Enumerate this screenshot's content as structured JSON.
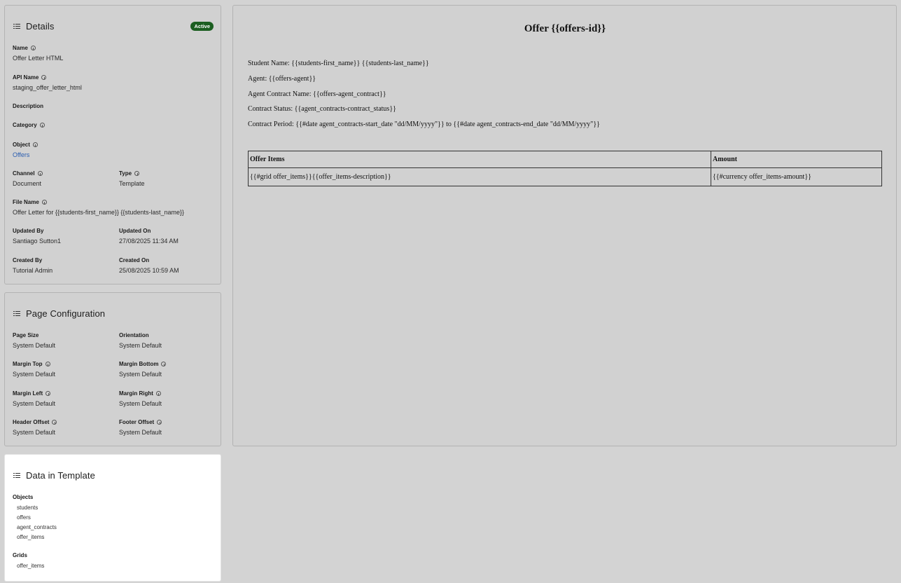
{
  "details": {
    "title": "Details",
    "status_badge": "Active",
    "name_label": "Name",
    "name_value": "Offer Letter HTML",
    "api_name_label": "API Name",
    "api_name_value": "staging_offer_letter_html",
    "description_label": "Description",
    "category_label": "Category",
    "object_label": "Object",
    "object_value": "Offers",
    "channel_label": "Channel",
    "channel_value": "Document",
    "type_label": "Type",
    "type_value": "Template",
    "file_name_label": "File Name",
    "file_name_value": "Offer Letter for {{students-first_name}} {{students-last_name}}",
    "updated_by_label": "Updated By",
    "updated_by_value": "Santiago Sutton1",
    "updated_on_label": "Updated On",
    "updated_on_value": "27/08/2025 11:34 AM",
    "created_by_label": "Created By",
    "created_by_value": "Tutorial Admin",
    "created_on_label": "Created On",
    "created_on_value": "25/08/2025 10:59 AM",
    "accent_color": "#1b5e20",
    "link_color": "#2a5db0"
  },
  "page_config": {
    "title": "Page Configuration",
    "page_size_label": "Page Size",
    "page_size_value": "System Default",
    "orientation_label": "Orientation",
    "orientation_value": "System Default",
    "margin_top_label": "Margin Top",
    "margin_top_value": "System Default",
    "margin_bottom_label": "Margin Bottom",
    "margin_bottom_value": "System Default",
    "margin_left_label": "Margin Left",
    "margin_left_value": "System Default",
    "margin_right_label": "Margin Right",
    "margin_right_value": "System Default",
    "header_offset_label": "Header Offset",
    "header_offset_value": "System Default",
    "footer_offset_label": "Footer Offset",
    "footer_offset_value": "System Default"
  },
  "data_in_template": {
    "title": "Data in Template",
    "objects_label": "Objects",
    "objects": [
      "students",
      "offers",
      "agent_contracts",
      "offer_items"
    ],
    "grids_label": "Grids",
    "grids": [
      "offer_items"
    ]
  },
  "preview": {
    "title": "Offer {{offers-id}}",
    "lines": [
      "Student Name: {{students-first_name}} {{students-last_name}}",
      "Agent: {{offers-agent}}",
      "Agent Contract Name: {{offers-agent_contract}}",
      "Contract Status: {{agent_contracts-contract_status}}",
      "Contract Period: {{#date agent_contracts-start_date \"dd/MM/yyyy\"}} to {{#date agent_contracts-end_date \"dd/MM/yyyy\"}}"
    ],
    "table_headers": [
      "Offer Items",
      "Amount"
    ],
    "table_row": [
      "{{#grid offer_items}}{{offer_items-description}}",
      "{{#currency offer_items-amount}}"
    ]
  }
}
